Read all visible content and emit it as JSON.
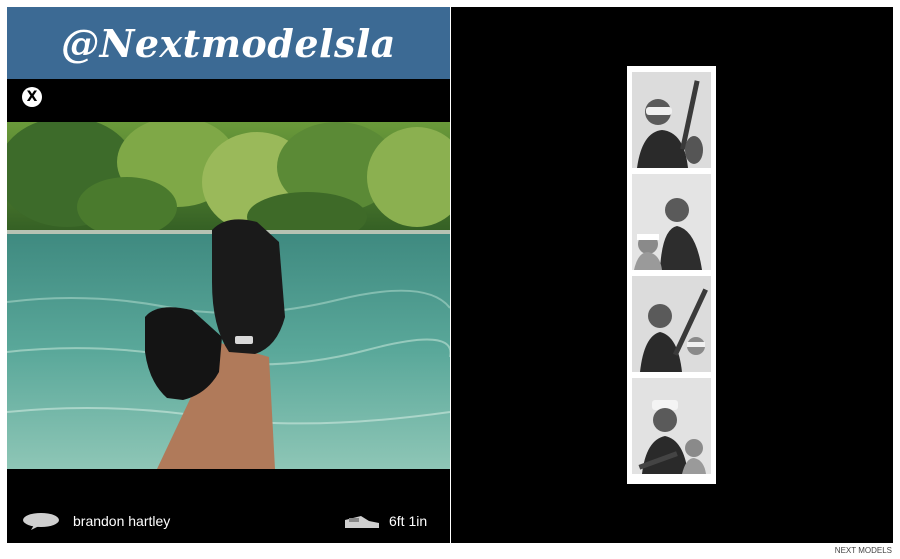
{
  "header": {
    "title": "@Nextmodelsla"
  },
  "close_button": {
    "label": "X"
  },
  "main_photo": {
    "description_icon": "image"
  },
  "footer": {
    "author_icon": "speech-bubble-icon",
    "author_name": "brandon hartley",
    "height_icon": "shoe-icon",
    "height_value": "6ft 1in"
  },
  "photo_strip": {
    "frames": 4
  },
  "brand": {
    "label": "NEXT MODELS"
  },
  "colors": {
    "header_bg": "#3c6a94",
    "panel_bg": "#000000",
    "text": "#ffffff"
  }
}
